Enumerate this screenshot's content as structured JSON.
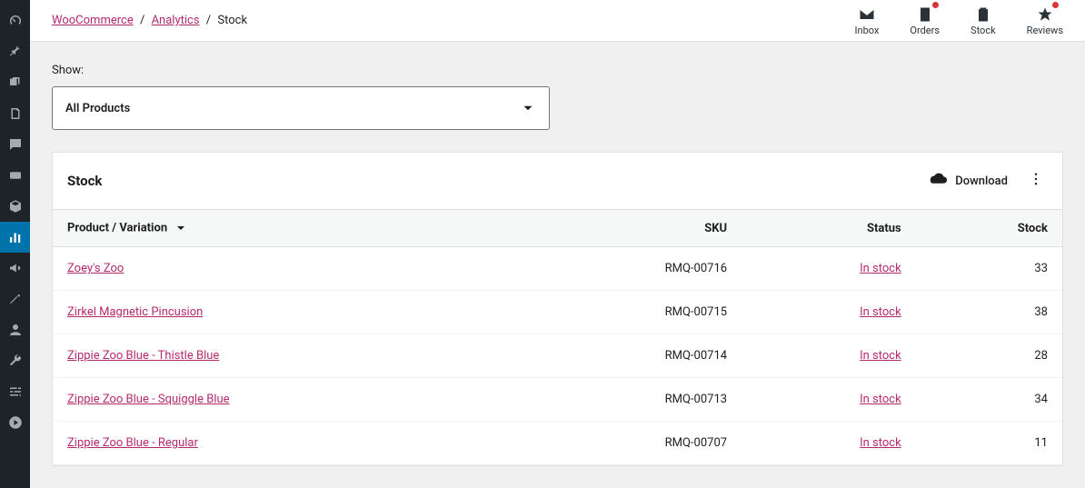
{
  "breadcrumbs": {
    "root": "WooCommerce",
    "mid": "Analytics",
    "current": "Stock"
  },
  "shortcuts": {
    "inbox": "Inbox",
    "orders": "Orders",
    "stock": "Stock",
    "reviews": "Reviews"
  },
  "filter": {
    "label": "Show:",
    "value": "All Products"
  },
  "card": {
    "title": "Stock",
    "download": "Download"
  },
  "columns": {
    "product": "Product / Variation",
    "sku": "SKU",
    "status": "Status",
    "stock": "Stock"
  },
  "rows": [
    {
      "product": "Zoey's Zoo",
      "sku": "RMQ-00716",
      "status": "In stock",
      "stock": "33"
    },
    {
      "product": "Zirkel Magnetic Pincusion",
      "sku": "RMQ-00715",
      "status": "In stock",
      "stock": "38"
    },
    {
      "product": "Zippie Zoo Blue - Thistle Blue",
      "sku": "RMQ-00714",
      "status": "In stock",
      "stock": "28"
    },
    {
      "product": "Zippie Zoo Blue - Squiggle Blue",
      "sku": "RMQ-00713",
      "status": "In stock",
      "stock": "34"
    },
    {
      "product": "Zippie Zoo Blue - Regular",
      "sku": "RMQ-00707",
      "status": "In stock",
      "stock": "11"
    }
  ]
}
